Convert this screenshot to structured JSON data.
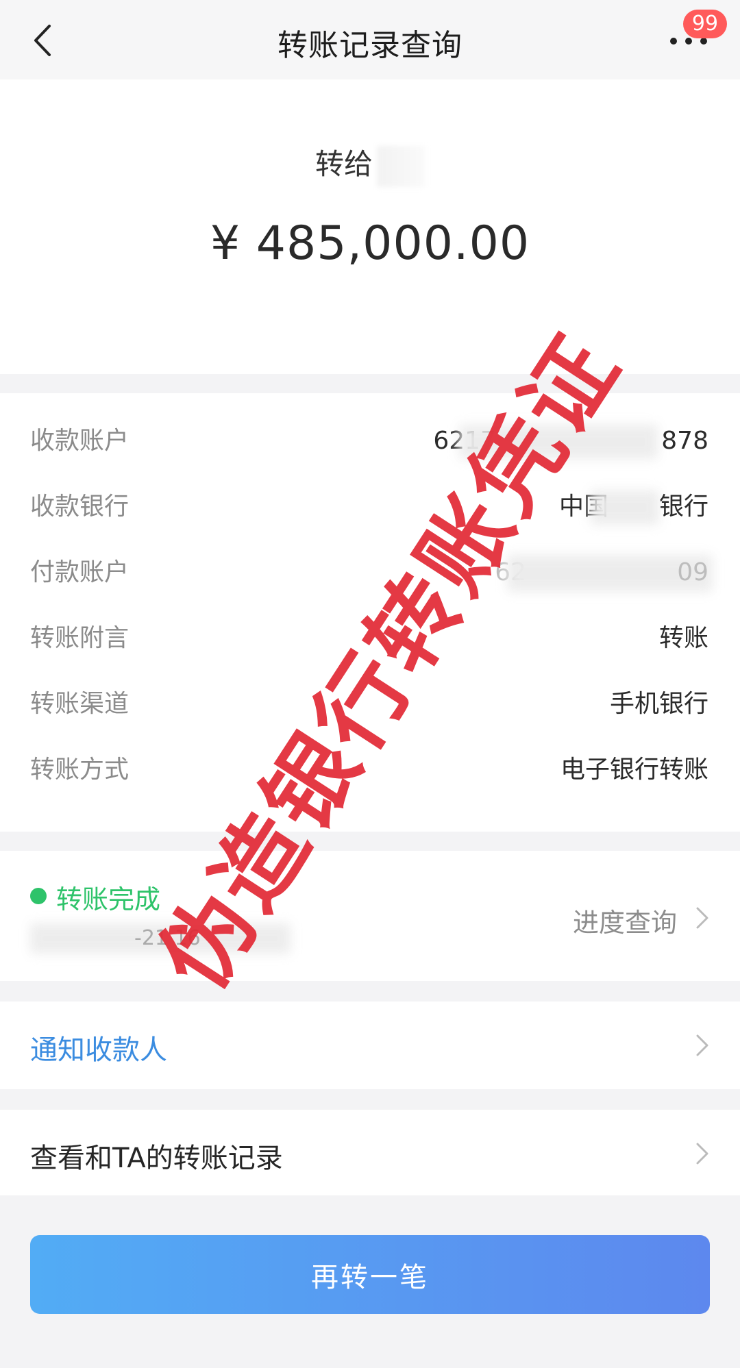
{
  "header": {
    "title": "转账记录查询",
    "back_icon": "chevron-left-icon",
    "more_icon": "ellipsis-icon",
    "badge_count": "99"
  },
  "summary": {
    "transfer_to_label": "转给",
    "amount": "¥ 485,000.00"
  },
  "details": [
    {
      "label": "收款账户",
      "value": "6217",
      "value_suffix": "878"
    },
    {
      "label": "收款银行",
      "value": "中国",
      "value_suffix": "银行"
    },
    {
      "label": "付款账户",
      "value": "62",
      "value_suffix": "09"
    },
    {
      "label": "转账附言",
      "value": "转账"
    },
    {
      "label": "转账渠道",
      "value": "手机银行"
    },
    {
      "label": "转账方式",
      "value": "电子银行转账"
    }
  ],
  "status": {
    "text": "转账完成",
    "time_fragment": "-21 16",
    "progress_link": "进度查询",
    "status_color": "#2ec36a"
  },
  "actions": {
    "notify_payee": "通知收款人",
    "view_history": "查看和TA的转账记录",
    "transfer_again": "再转一笔"
  },
  "watermark": {
    "text": "伪造银行转账凭证",
    "color": "#e22834"
  },
  "colors": {
    "link_blue": "#3b8ce0",
    "button_gradient_start": "#52acf5",
    "button_gradient_end": "#5d88ee",
    "badge_red": "#ff5a5a"
  }
}
